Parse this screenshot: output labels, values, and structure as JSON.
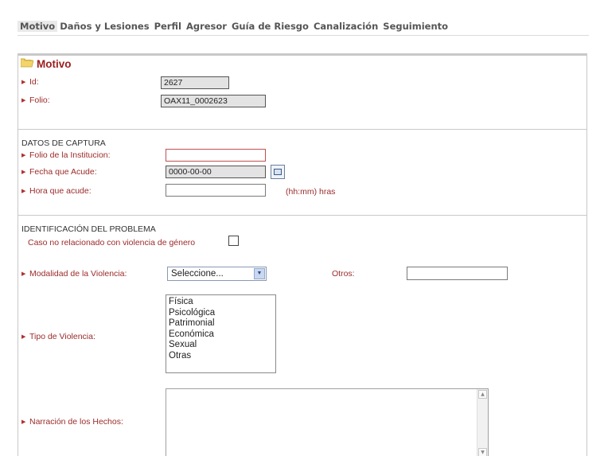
{
  "tabs": [
    {
      "label": "Motivo",
      "active": true
    },
    {
      "label": "Daños y Lesiones",
      "active": false
    },
    {
      "label": "Perfil",
      "active": false
    },
    {
      "label": "Agresor",
      "active": false
    },
    {
      "label": "Guía de Riesgo",
      "active": false
    },
    {
      "label": "Canalización",
      "active": false
    },
    {
      "label": "Seguimiento",
      "active": false
    }
  ],
  "panel": {
    "title": "Motivo",
    "icon": "folder-icon"
  },
  "id_section": {
    "id_label": "Id:",
    "id_value": "2627",
    "folio_label": "Folio:",
    "folio_value": "OAX11_0002623"
  },
  "captura": {
    "heading": "DATOS DE CAPTURA",
    "folio_institucion_label": "Folio de la Institucion:",
    "folio_institucion_value": "",
    "fecha_label": "Fecha que Acude:",
    "fecha_value": "0000-00-00",
    "calendar_icon": "calendar-icon",
    "hora_label": "Hora que acude:",
    "hora_value": "",
    "hora_hint": "(hh:mm) hras"
  },
  "problema": {
    "heading": "IDENTIFICACIÓN DEL PROBLEMA",
    "no_relacionado_label": "Caso no relacionado con violencia de género",
    "no_relacionado_checked": false,
    "modalidad_label": "Modalidad de la Violencia:",
    "modalidad_value": "Seleccione...",
    "otros_label": "Otros:",
    "otros_value": "",
    "tipo_label": "Tipo de Violencia:",
    "tipo_options": [
      "Física",
      "Psicológica",
      "Patrimonial",
      "Económica",
      "Sexual",
      "Otras"
    ],
    "narracion_label": "Narración de los Hechos:",
    "narracion_value": ""
  },
  "colors": {
    "label_red": "#9c2a2a",
    "title_red": "#9c1d1d",
    "active_tab_bg": "#e9e9e9"
  }
}
